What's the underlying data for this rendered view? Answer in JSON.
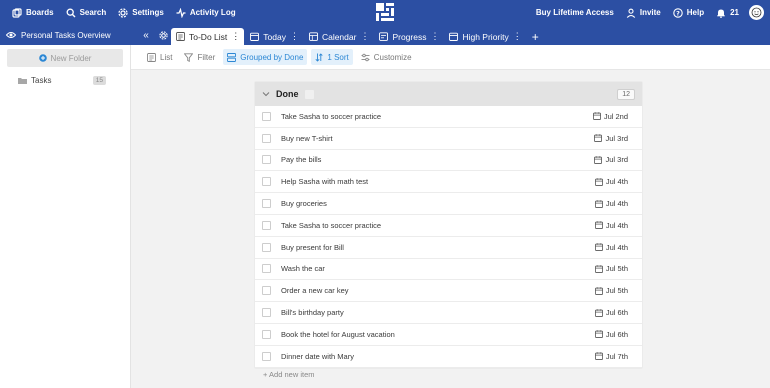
{
  "topbar": {
    "boards": "Boards",
    "search": "Search",
    "settings": "Settings",
    "activity_log": "Activity Log",
    "buy_lifetime": "Buy Lifetime Access",
    "invite": "Invite",
    "help": "Help",
    "notifications_count": "21"
  },
  "project": {
    "title": "Personal Tasks Overview"
  },
  "tabs": [
    {
      "label": "To-Do List",
      "icon": "list-icon"
    },
    {
      "label": "Today",
      "icon": "calendar-icon"
    },
    {
      "label": "Calendar",
      "icon": "table-icon"
    },
    {
      "label": "Progress",
      "icon": "progress-icon"
    },
    {
      "label": "High Priority",
      "icon": "calendar-icon"
    }
  ],
  "sidebar": {
    "new_folder": "New Folder",
    "folders": [
      {
        "label": "Tasks",
        "count": "15"
      }
    ]
  },
  "toolbar": {
    "list": "List",
    "filter": "Filter",
    "grouped": "Grouped by Done",
    "sort": "1 Sort",
    "customize": "Customize"
  },
  "group": {
    "title": "Done",
    "count": "12",
    "add_new": "+ Add new item"
  },
  "tasks": [
    {
      "name": "Take Sasha to soccer practice",
      "date": "Jul 2nd"
    },
    {
      "name": "Buy new T-shirt",
      "date": "Jul 3rd"
    },
    {
      "name": "Pay the bills",
      "date": "Jul 3rd"
    },
    {
      "name": "Help Sasha with math test",
      "date": "Jul 4th"
    },
    {
      "name": "Buy groceries",
      "date": "Jul 4th"
    },
    {
      "name": "Take Sasha to soccer practice",
      "date": "Jul 4th"
    },
    {
      "name": "Buy present for Bill",
      "date": "Jul 4th"
    },
    {
      "name": "Wash the car",
      "date": "Jul 5th"
    },
    {
      "name": "Order a new car key",
      "date": "Jul 5th"
    },
    {
      "name": "Bill's birthday party",
      "date": "Jul 6th"
    },
    {
      "name": "Book the hotel for August vacation",
      "date": "Jul 6th"
    },
    {
      "name": "Dinner date with Mary",
      "date": "Jul 7th"
    }
  ],
  "colors": {
    "brand": "#2c4fa3",
    "accent": "#2c87d4",
    "group_header": "#e3e3e3"
  }
}
